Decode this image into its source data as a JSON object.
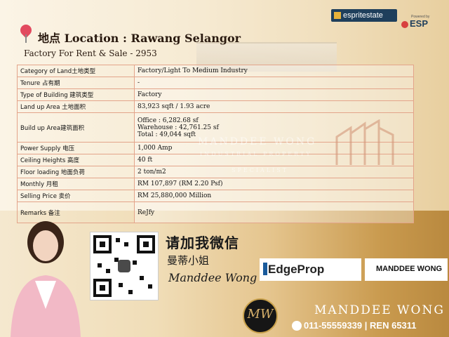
{
  "header": {
    "location_prefix": "地点",
    "location": "Location : Rawang Selangor",
    "subtitle": "Factory For Rent & Sale - 2953"
  },
  "brand": {
    "name": "espritestate",
    "powered_by": "Powered by",
    "esp": "ESP"
  },
  "specs": [
    {
      "label": "Category of Land土地类型",
      "value": "Factory/Light To Medium Industry"
    },
    {
      "label": "Tenure 占有期",
      "value": "-"
    },
    {
      "label": "Type of Building 建筑类型",
      "value": "Factory"
    },
    {
      "label": "Land up Area 土地面积",
      "value": "83,923 sqft / 1.93 acre"
    },
    {
      "label": "Build up Area建筑面积",
      "lines": [
        "Office : 6,282.68 sf",
        "Warehouse : 42,761.25 sf",
        "Total : 49,044 sqft"
      ]
    },
    {
      "label": "Power Supply 电压",
      "value": "1,000  Amp"
    },
    {
      "label": "Ceiling Heights 高度",
      "value": "40 ft"
    },
    {
      "label": "Floor loading 地面负荷",
      "value": "2 ton/m2"
    },
    {
      "label": "Monthly 月租",
      "value": "RM 107,897 (RM 2.20 Psf)"
    },
    {
      "label": "Selling Price 卖价",
      "value": "RM 25,880,000 Million"
    },
    {
      "label": "Remarks 备注",
      "value": "ReJfy"
    }
  ],
  "watermark": {
    "line1": "MANDDEE WONG",
    "line2": "INDUSTRIAL PROPERTY",
    "line3": "SPECIALIST"
  },
  "agent": {
    "wechat_cta": "请加我微信",
    "name_cn": "曼蒂小姐",
    "signature": "Manddee Wong",
    "portal": "EdgeProp",
    "name_box": "MANDDEE WONG",
    "logo_text": "MW",
    "name_big": "MANDDEE WONG",
    "phone": "011-55559339",
    "ren": "REN 65311"
  },
  "colors": {
    "pin": "#e24a5f",
    "table_border": "#e3a48a",
    "gold": "#c9a14b"
  }
}
